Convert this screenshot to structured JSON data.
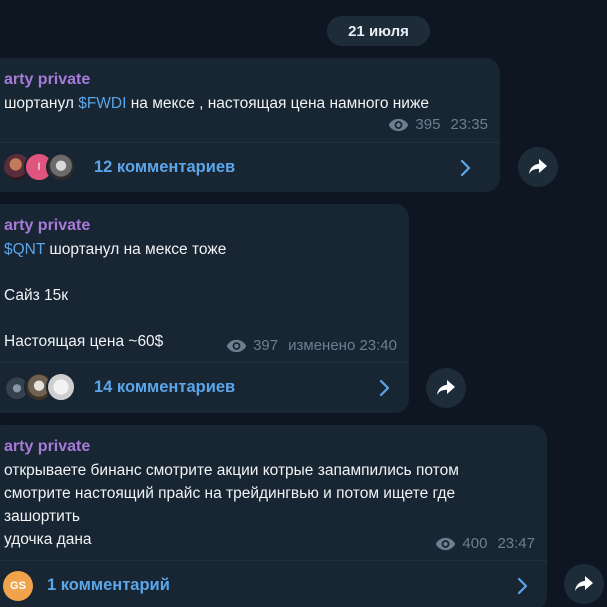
{
  "date_separator": "21 июля",
  "colors": {
    "background": "#0e1621",
    "bubble": "#182533",
    "author": "#a67bd8",
    "link": "#5ba6e8",
    "meta": "#6d7f8f",
    "avatar_gs": "#f0a34a"
  },
  "posts": [
    {
      "author": "arty private",
      "text_pre": "шортанул ",
      "ticker": "$FWDI",
      "text_post": " на мексе , настоящая цена намного ниже",
      "views": "395",
      "time": "23:35",
      "comments_label": "12 комментариев"
    },
    {
      "author": "arty private",
      "ticker": "$QNT",
      "line1_post": " шортанул на мексе тоже",
      "line2": "Сайз 15к",
      "line3": "Настоящая цена ~60$",
      "views": "397",
      "time": "изменено 23:40",
      "comments_label": "14 комментариев"
    },
    {
      "author": "arty private",
      "lines": [
        "открываете бинанс смотрите акции котрые запампились потом",
        "смотрите настоящий прайс на трейдингвью и потом ищете где",
        "зашортить",
        "удочка дана"
      ],
      "views": "400",
      "time": "23:47",
      "avatar_initials": "GS",
      "comments_label": "1 комментарий"
    }
  ],
  "icons": {
    "views": "eye-icon",
    "open_comments": "chevron-right-icon",
    "share": "share-arrow-icon"
  }
}
